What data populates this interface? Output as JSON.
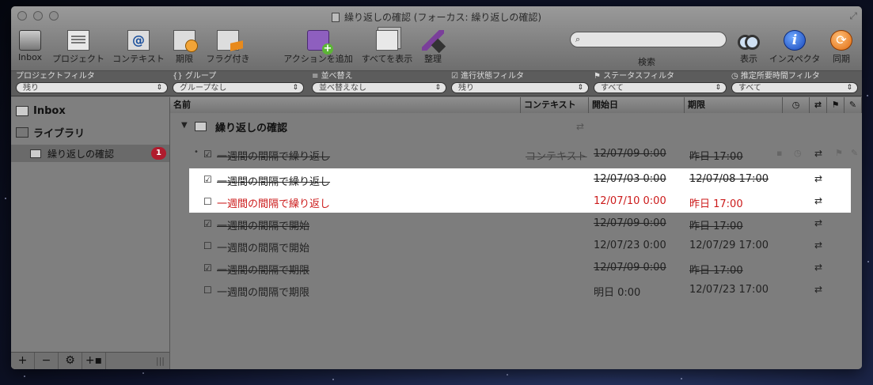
{
  "window": {
    "title": "繰り返しの確認 (フォーカス: 繰り返しの確認)"
  },
  "toolbar": {
    "inbox": "Inbox",
    "projects": "プロジェクト",
    "contexts": "コンテキスト",
    "due": "期限",
    "flagged": "フラグ付き",
    "add_action": "アクションを追加",
    "show_all": "すべてを表示",
    "clean_up": "整理",
    "search_label": "検索",
    "view": "表示",
    "inspector": "インスペクタ",
    "sync": "同期"
  },
  "filters": [
    {
      "label": "プロジェクトフィルタ",
      "value": "残り"
    },
    {
      "label": "グループ",
      "value": "グループなし"
    },
    {
      "label": "並べ替え",
      "value": "並べ替えなし"
    },
    {
      "label": "進行状態フィルタ",
      "value": "残り"
    },
    {
      "label": "ステータスフィルタ",
      "value": "すべて"
    },
    {
      "label": "推定所要時間フィルタ",
      "value": "すべて"
    }
  ],
  "sidebar": {
    "inbox": "Inbox",
    "library": "ライブラリ",
    "project": "繰り返しの確認",
    "badge": "1"
  },
  "columns": {
    "name": "名前",
    "context": "コンテキスト",
    "start": "開始日",
    "due": "期限"
  },
  "group": {
    "title": "繰り返しの確認"
  },
  "rows": [
    {
      "title": "一週間の間隔で繰り返し",
      "context": "コンテキスト",
      "start": "12/07/09 0:00",
      "due": "昨日 17:00",
      "done": true
    },
    {
      "title": "一週間の間隔で繰り返し",
      "context": "",
      "start": "12/07/03 0:00",
      "due": "12/07/08 17:00",
      "done": true
    },
    {
      "title": "一週間の間隔で繰り返し",
      "context": "",
      "start": "12/07/10 0:00",
      "due": "昨日 17:00",
      "done": false
    },
    {
      "title": "一週間の間隔で開始",
      "context": "",
      "start": "12/07/09 0:00",
      "due": "昨日 17:00",
      "done": true
    },
    {
      "title": "一週間の間隔で開始",
      "context": "",
      "start": "12/07/23 0:00",
      "due": "12/07/29 17:00",
      "done": false
    },
    {
      "title": "一週間の間隔で期限",
      "context": "",
      "start": "12/07/09 0:00",
      "due": "昨日 17:00",
      "done": true
    },
    {
      "title": "一週間の間隔で期限",
      "context": "",
      "start": "明日 0:00",
      "due": "12/07/23 17:00",
      "done": false
    }
  ],
  "icons": {
    "checked": "☑",
    "unchecked": "☐",
    "repeat": "⇄",
    "search": "⌕"
  },
  "colors": {
    "overdue": "#cc1a1a",
    "highlight": "#ffffff",
    "badge": "#b01c2e"
  }
}
